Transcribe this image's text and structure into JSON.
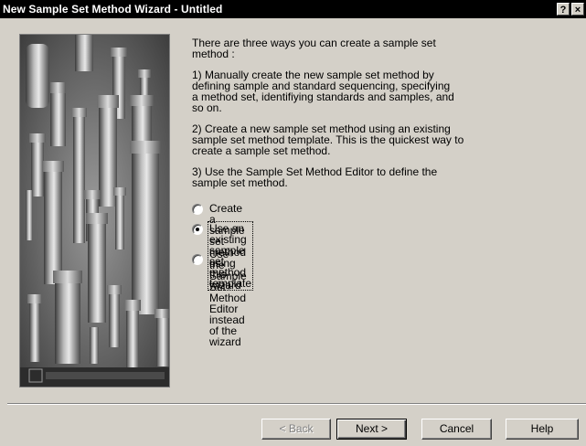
{
  "window": {
    "title": "New Sample Set Method Wizard - Untitled",
    "help_button": "?",
    "close_button": "×"
  },
  "intro": {
    "p0": "There are three ways you can create a sample set\nmethod :",
    "p1": "1) Manually create the new sample set method by\ndefining sample and standard sequencing, specifying\na method set, identifiying standards and samples, and\nso on.",
    "p2": "2) Create a new sample set method using an existing\nsample set method template. This is the quickest way to\ncreate a sample set method.",
    "p3": "3) Use the Sample Set Method Editor to define the\nsample set method."
  },
  "options": [
    {
      "label": "Create a sample set method using this wizard",
      "selected": false
    },
    {
      "label": "Use an existing sample set method template",
      "selected": true
    },
    {
      "label": "Use the Sample Set Method Editor instead of the\nwizard",
      "selected": false
    }
  ],
  "buttons": {
    "back": "< Back",
    "next": "Next >",
    "cancel": "Cancel",
    "help": "Help"
  },
  "colors": {
    "titlebar": "#000000",
    "face": "#d4d0c8"
  }
}
